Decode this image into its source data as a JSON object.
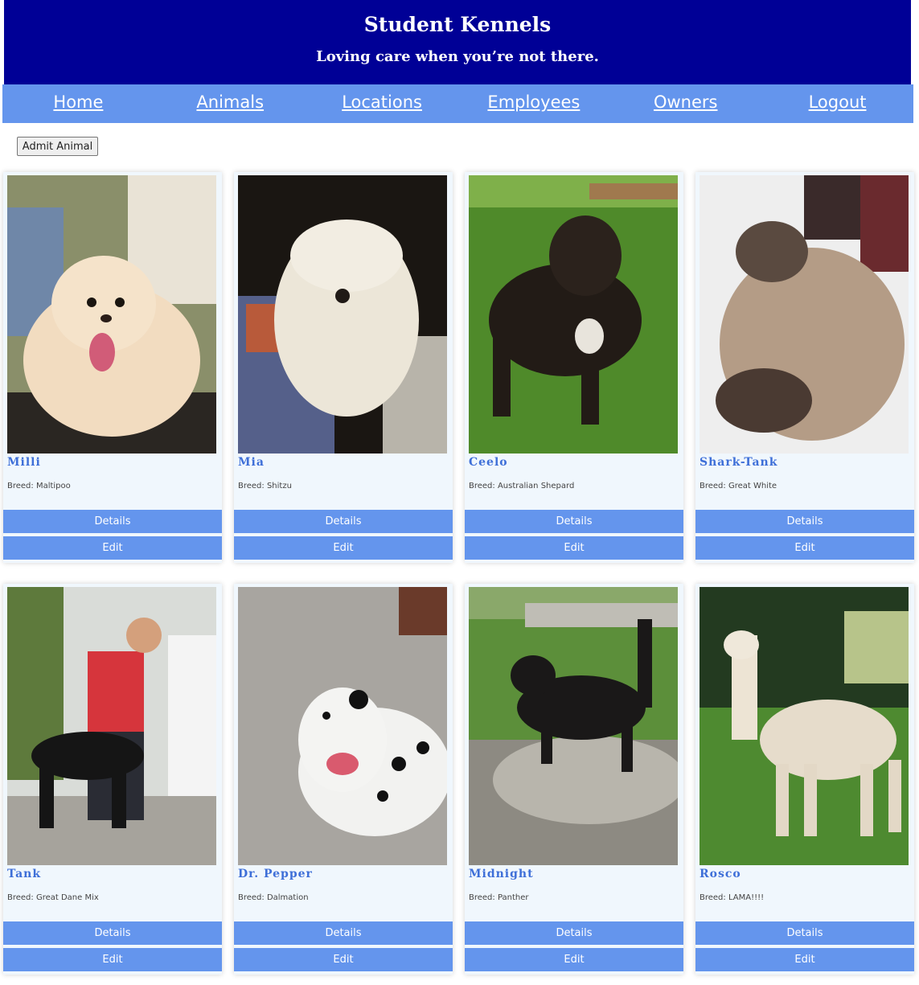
{
  "header": {
    "title": "Student Kennels",
    "tagline": "Loving care when you’re not there."
  },
  "nav": {
    "home": "Home",
    "animals": "Animals",
    "locations": "Locations",
    "employees": "Employees",
    "owners": "Owners",
    "logout": "Logout"
  },
  "admit_button": "Admit Animal",
  "card_buttons": {
    "details": "Details",
    "edit": "Edit"
  },
  "animals": [
    {
      "name": "Milli",
      "breed": "Breed: Maltipoo"
    },
    {
      "name": "Mia",
      "breed": "Breed: Shitzu"
    },
    {
      "name": "Ceelo",
      "breed": "Breed: Australian Shepard"
    },
    {
      "name": "Shark-Tank",
      "breed": "Breed: Great White"
    },
    {
      "name": "Tank",
      "breed": "Breed: Great Dane Mix"
    },
    {
      "name": "Dr. Pepper",
      "breed": "Breed: Dalmation"
    },
    {
      "name": "Midnight",
      "breed": "Breed: Panther"
    },
    {
      "name": "Rosco",
      "breed": "Breed: LAMA!!!!"
    }
  ],
  "colors": {
    "header_bg": "#000096",
    "nav_bg": "#6495ed",
    "card_bg": "#f0f7fd",
    "name_color": "#3e6fd8"
  }
}
